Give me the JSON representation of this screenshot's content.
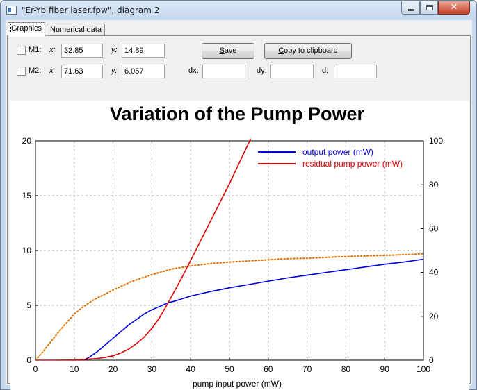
{
  "window": {
    "title": "\"Er-Yb fiber laser.fpw\", diagram 2",
    "close_glyph": "✕"
  },
  "tabs": [
    {
      "label": "Graphics",
      "active": true
    },
    {
      "label": "Numerical data",
      "active": false
    }
  ],
  "markers": {
    "m1": {
      "label": "M1:",
      "x_label": "x:",
      "x_value": "32.85",
      "y_label": "y:",
      "y_value": "14.89",
      "checked": false
    },
    "m2": {
      "label": "M2:",
      "x_label": "x:",
      "x_value": "71.63",
      "y_label": "y:",
      "y_value": "6.057",
      "checked": false
    }
  },
  "buttons": {
    "save": "Save",
    "copy": "Copy to clipboard"
  },
  "diffs": {
    "dx_label": "dx:",
    "dx_value": "",
    "dy_label": "dy:",
    "dy_value": "",
    "d_label": "d:",
    "d_value": ""
  },
  "chart_data": {
    "type": "line",
    "title": "Variation of the Pump Power",
    "xlabel": "pump input power (mW)",
    "xlim": [
      0,
      100
    ],
    "ylim_left": [
      0,
      20
    ],
    "ylim_right": [
      0,
      100
    ],
    "x_ticks": [
      0,
      10,
      20,
      30,
      40,
      50,
      60,
      70,
      80,
      90,
      100
    ],
    "y_ticks_left": [
      0,
      5,
      10,
      15,
      20
    ],
    "y_ticks_right": [
      0,
      20,
      40,
      60,
      80,
      100
    ],
    "grid": true,
    "legend_position": "top-right",
    "series": [
      {
        "name": "output power (mW)",
        "axis": "left",
        "color": "#0000dd",
        "style": "solid",
        "x": [
          12.5,
          14,
          16,
          18,
          20,
          22,
          24,
          26,
          28,
          30,
          32,
          34,
          36,
          40,
          45,
          50,
          55,
          60,
          65,
          70,
          75,
          80,
          85,
          90,
          95,
          100
        ],
        "y": [
          0,
          0.3,
          0.8,
          1.4,
          2.0,
          2.6,
          3.2,
          3.7,
          4.2,
          4.6,
          4.9,
          5.2,
          5.4,
          5.85,
          6.25,
          6.6,
          6.9,
          7.2,
          7.5,
          7.75,
          8.0,
          8.25,
          8.5,
          8.75,
          8.95,
          9.2
        ]
      },
      {
        "name": "residual pump power (mW)",
        "axis": "right",
        "color": "#dd0000",
        "style": "solid",
        "x": [
          0,
          5,
          10,
          12,
          14,
          16,
          18,
          20,
          22,
          24,
          26,
          28,
          30,
          32,
          34,
          36,
          38,
          40,
          42,
          44,
          46,
          48,
          50,
          52,
          54,
          55.5
        ],
        "y": [
          0,
          0,
          0.1,
          0.3,
          0.5,
          0.8,
          1.3,
          2.0,
          3.3,
          5.0,
          7.5,
          10.5,
          14.5,
          19.5,
          25.5,
          32,
          38.5,
          45.5,
          52.5,
          59.5,
          66.5,
          73.5,
          80.5,
          88,
          95.5,
          101
        ]
      },
      {
        "axis": "left",
        "color": "#e07000",
        "style": "dotted",
        "x": [
          0,
          2,
          4,
          6,
          8,
          10,
          12,
          15,
          20,
          25,
          30,
          35,
          40,
          45,
          50,
          55,
          60,
          65,
          70,
          75,
          80,
          85,
          90,
          95,
          100
        ],
        "y": [
          0,
          0.8,
          1.7,
          2.6,
          3.4,
          4.2,
          4.8,
          5.5,
          6.4,
          7.2,
          7.8,
          8.3,
          8.6,
          8.8,
          8.95,
          9.05,
          9.15,
          9.25,
          9.3,
          9.38,
          9.45,
          9.5,
          9.55,
          9.62,
          9.7
        ]
      }
    ]
  }
}
